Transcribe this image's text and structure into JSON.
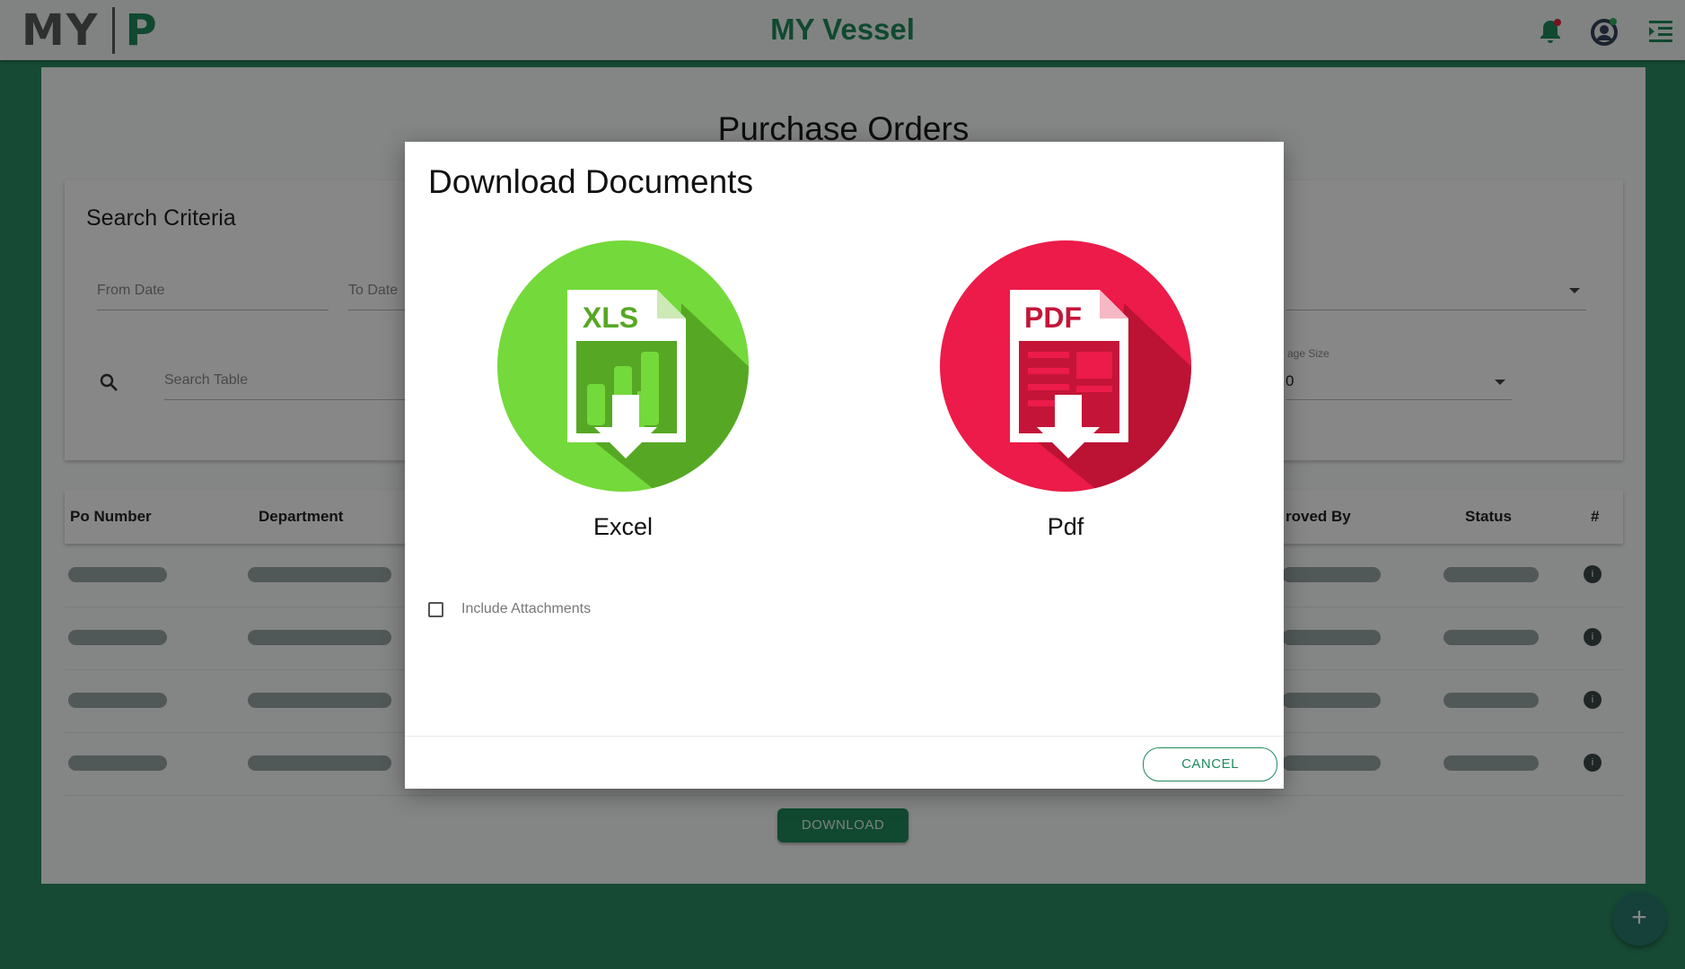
{
  "header": {
    "logo_left": "MY",
    "logo_right": "P",
    "title": "MY Vessel",
    "icons": [
      "bell-icon",
      "user-account-icon",
      "menu-collapse-icon"
    ]
  },
  "page": {
    "title": "Purchase Orders"
  },
  "search": {
    "heading": "Search Criteria",
    "from_date_label": "From Date",
    "to_date_label": "To Date",
    "search_placeholder": "Search Table",
    "page_size_label": "age Size",
    "page_size_value": "0"
  },
  "table": {
    "columns": [
      "Po Number",
      "Department",
      "roved By",
      "Status",
      "#"
    ],
    "row_count": 4
  },
  "actions": {
    "download_label": "DOWNLOAD",
    "fab_label": "+"
  },
  "dialog": {
    "title": "Download Documents",
    "options": [
      {
        "label": "Excel",
        "badge": "XLS",
        "color": "#74d93a"
      },
      {
        "label": "Pdf",
        "badge": "PDF",
        "color": "#ec1b49"
      }
    ],
    "include_attachments_label": "Include Attachments",
    "include_attachments_checked": false,
    "cancel_label": "CANCEL"
  },
  "colors": {
    "brand_green": "#1f8a5c",
    "excel_green": "#74d93a",
    "pdf_red": "#ec1b49"
  }
}
